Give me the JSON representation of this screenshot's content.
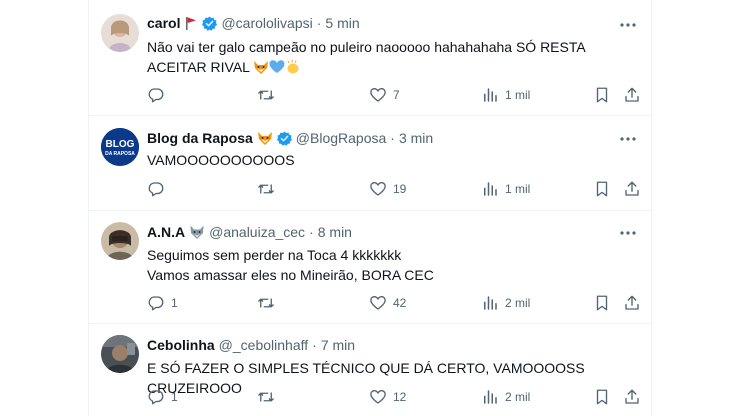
{
  "tweets": [
    {
      "name": "carol",
      "handle": "@carololivapsi",
      "dot": "·",
      "time": "5 min",
      "text_lines": [
        "Não vai ter galo campeão no puleiro naooooo hahahahaha SÓ RESTA",
        "ACEITAR RIVAL"
      ],
      "replies": "",
      "retweets": "",
      "likes": "7",
      "views": "1 mil",
      "verified": true,
      "has_flag": true,
      "emojis": [
        "fox-emoji",
        "blue-heart-emoji",
        "clap-emoji"
      ]
    },
    {
      "name": "Blog da Raposa",
      "handle": "@BlogRaposa",
      "dot": "·",
      "time": "3 min",
      "text_lines": [
        "VAMOOOOOOOOOOS"
      ],
      "replies": "",
      "retweets": "",
      "likes": "19",
      "views": "1 mil",
      "verified": true,
      "avatar_text": [
        "BLOG",
        "DA RAPOSA"
      ]
    },
    {
      "name": "A.N.A",
      "handle": "@analuiza_cec",
      "dot": "·",
      "time": "8 min",
      "text_lines": [
        "Seguimos sem perder na Toca 4 kkkkkkk",
        "Vamos amassar eles no Mineirão, BORA CEC"
      ],
      "replies": "1",
      "retweets": "",
      "likes": "42",
      "views": "2 mil",
      "verified": false
    },
    {
      "name": "Cebolinha",
      "handle": "@_cebolinhaff",
      "dot": "·",
      "time": "7 min",
      "text_lines": [
        "E SÓ FAZER O SIMPLES TÉCNICO QUE DÁ CERTO, VAMOOOOSS CRUZEIROOO"
      ],
      "replies": "1",
      "retweets": "",
      "likes": "12",
      "views": "2 mil",
      "verified": false
    }
  ],
  "colors": {
    "text": "#0f1419",
    "secondary": "#536471",
    "verified": "#1d9bf0",
    "divider": "#eff3f4"
  }
}
